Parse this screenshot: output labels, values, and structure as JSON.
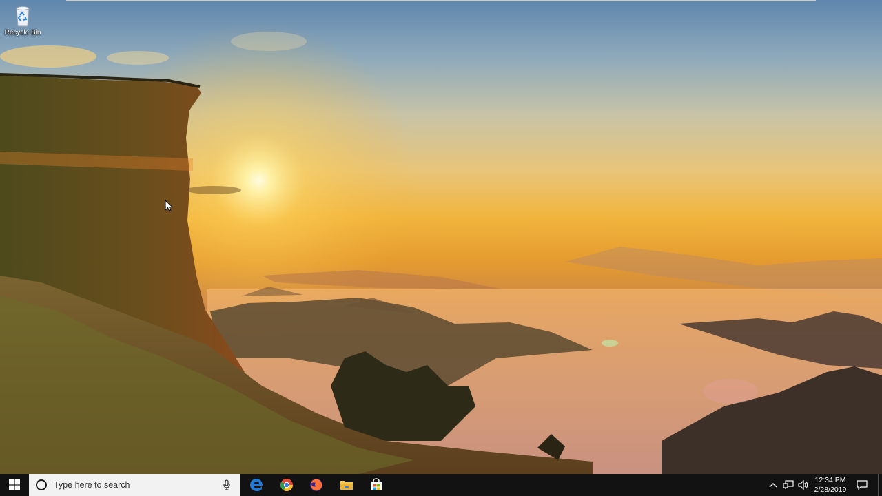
{
  "desktop": {
    "icons": [
      {
        "label": "Recycle Bin",
        "icon": "recycle-bin-icon"
      }
    ]
  },
  "taskbar": {
    "start": {
      "icon": "windows-logo-icon"
    },
    "search": {
      "placeholder": "Type here to search",
      "cortana_icon": "cortana-circle-icon",
      "mic_icon": "microphone-icon"
    },
    "pinned_apps": [
      {
        "name": "Microsoft Edge",
        "icon": "edge-icon",
        "color": "#1e7ad6"
      },
      {
        "name": "Google Chrome",
        "icon": "chrome-icon",
        "color": "#dd4b39"
      },
      {
        "name": "Firefox",
        "icon": "firefox-icon",
        "color": "#ff7139"
      },
      {
        "name": "File Explorer",
        "icon": "file-explorer-icon",
        "color": "#f3c64b"
      },
      {
        "name": "Microsoft Store",
        "icon": "store-icon",
        "color": "#ffffff"
      }
    ],
    "tray": {
      "icons": [
        "chevron-up-icon",
        "network-icon",
        "volume-icon"
      ],
      "time": "12:34 PM",
      "date": "2/28/2019",
      "notification_icon": "action-center-icon"
    }
  },
  "colors": {
    "taskbar_bg": "#121212",
    "search_bg": "#f2f2f2",
    "windows_blue": "#ffffff"
  }
}
